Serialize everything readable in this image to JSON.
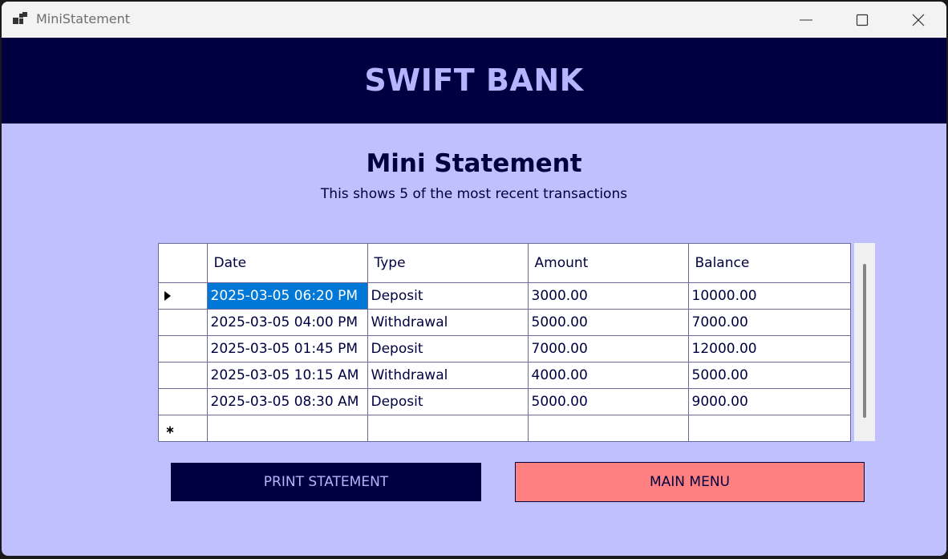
{
  "window": {
    "title": "MiniStatement",
    "icon": "app-windows-icon",
    "controls": [
      "minimize-icon",
      "maximize-icon",
      "close-icon"
    ]
  },
  "header": {
    "bank_name": "SWIFT BANK"
  },
  "main": {
    "title": "Mini Statement",
    "subtitle": "This shows 5 of the most recent transactions"
  },
  "grid": {
    "columns": [
      "Date",
      "Type",
      "Amount",
      "Balance"
    ],
    "rows": [
      {
        "date": "2025-03-05 06:20 PM",
        "type": "Deposit",
        "amount": "3000.00",
        "balance": "10000.00"
      },
      {
        "date": "2025-03-05 04:00 PM",
        "type": "Withdrawal",
        "amount": "5000.00",
        "balance": "7000.00"
      },
      {
        "date": "2025-03-05 01:45 PM",
        "type": "Deposit",
        "amount": "7000.00",
        "balance": "12000.00"
      },
      {
        "date": "2025-03-05 10:15 AM",
        "type": "Withdrawal",
        "amount": "4000.00",
        "balance": "5000.00"
      },
      {
        "date": "2025-03-05 08:30 AM",
        "type": "Deposit",
        "amount": "5000.00",
        "balance": "9000.00"
      }
    ],
    "current_row_icon": "triangle-right-icon",
    "new_row_icon": "asterisk-icon"
  },
  "buttons": {
    "print_label": "PRINT STATEMENT",
    "menu_label": "MAIN MENU"
  },
  "colors": {
    "header_bg": "#000040",
    "body_bg": "#c0c0ff",
    "accent_text": "#b4b4ff",
    "menu_button_bg": "#ff8080",
    "selection": "#0078d7"
  }
}
